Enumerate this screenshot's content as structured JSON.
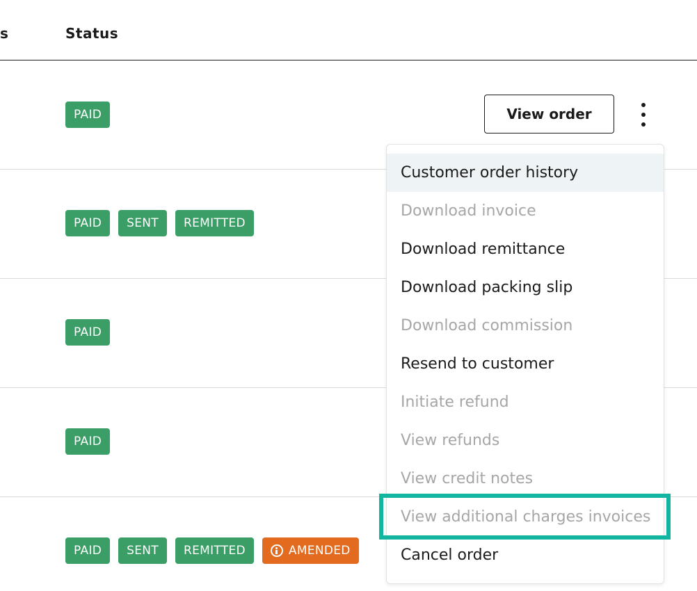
{
  "table": {
    "columns": {
      "previous": "s",
      "status": "Status"
    },
    "rows": [
      {
        "badges": [
          "PAID"
        ]
      },
      {
        "badges": [
          "PAID",
          "SENT",
          "REMITTED"
        ]
      },
      {
        "badges": [
          "PAID"
        ]
      },
      {
        "badges": [
          "PAID"
        ]
      },
      {
        "badges": [
          "PAID",
          "SENT",
          "REMITTED"
        ],
        "amended": "AMENDED"
      }
    ]
  },
  "actions": {
    "view_order": "View order",
    "more_icon": "kebab-menu-icon"
  },
  "menu": {
    "items": [
      {
        "label": "Customer order history",
        "disabled": false,
        "highlighted": true
      },
      {
        "label": "Download invoice",
        "disabled": true
      },
      {
        "label": "Download remittance",
        "disabled": false
      },
      {
        "label": "Download packing slip",
        "disabled": false
      },
      {
        "label": "Download commission",
        "disabled": true
      },
      {
        "label": "Resend to customer",
        "disabled": false
      },
      {
        "label": "Initiate refund",
        "disabled": true
      },
      {
        "label": "View refunds",
        "disabled": true
      },
      {
        "label": "View credit notes",
        "disabled": true
      },
      {
        "label": "View additional charges invoices",
        "disabled": true,
        "focused": true
      },
      {
        "label": "Cancel order",
        "disabled": false
      }
    ]
  },
  "colors": {
    "paid": "#3a9e66",
    "amended": "#e26b20",
    "focus": "#12b5a0",
    "highlight": "#eef3f6"
  }
}
